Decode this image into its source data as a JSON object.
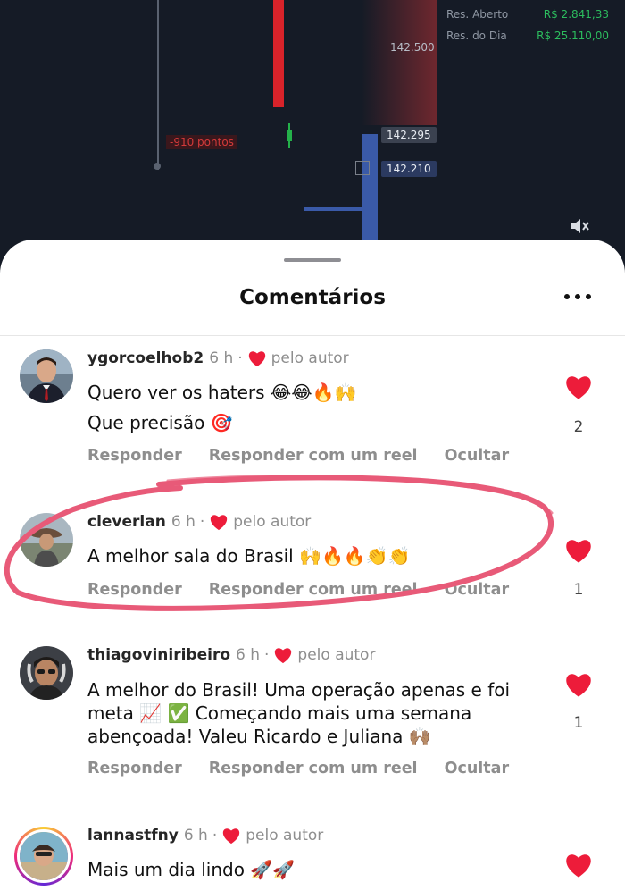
{
  "background_chart": {
    "res_aberto_label": "Res. Aberto",
    "res_aberto_value": "R$ 2.841,33",
    "res_dia_label": "Res. do Dia",
    "res_dia_value": "R$ 25.110,00",
    "level_label": "142.500",
    "price_tag_1": "142.295",
    "price_tag_2": "142.210",
    "points_label": "-910 pontos"
  },
  "sheet": {
    "title": "Comentários"
  },
  "comments": [
    {
      "username": "ygorcoelhob2",
      "time": "6 h",
      "by_author": "pelo autor",
      "lines": [
        "Quero ver os haters 😂😂🔥🙌",
        "Que precisão 🎯"
      ],
      "likes": "2",
      "actions": [
        "Responder",
        "Responder com um reel",
        "Ocultar"
      ]
    },
    {
      "username": "cleverlan",
      "time": "6 h",
      "by_author": "pelo autor",
      "lines": [
        "A melhor sala do Brasil 🙌🔥🔥👏👏"
      ],
      "likes": "1",
      "actions": [
        "Responder",
        "Responder com um reel",
        "Ocultar"
      ]
    },
    {
      "username": "thiagoviniribeiro",
      "time": "6 h",
      "by_author": "pelo autor",
      "lines": [
        "A melhor do Brasil! Uma operação apenas e foi",
        "meta 📈 ✅ Começando mais uma semana",
        "abençoada! Valeu Ricardo e Juliana 🙌🏽"
      ],
      "likes": "1",
      "actions": [
        "Responder",
        "Responder com um reel",
        "Ocultar"
      ]
    },
    {
      "username": "lannastfny",
      "time": "6 h",
      "by_author": "pelo autor",
      "lines": [
        "Mais um dia lindo 🚀🚀"
      ],
      "likes": "",
      "actions": []
    }
  ],
  "colors": {
    "heart": "#ed1c3a",
    "highlight_ring": "#e85a78",
    "muted_text": "#8e8e8e"
  }
}
